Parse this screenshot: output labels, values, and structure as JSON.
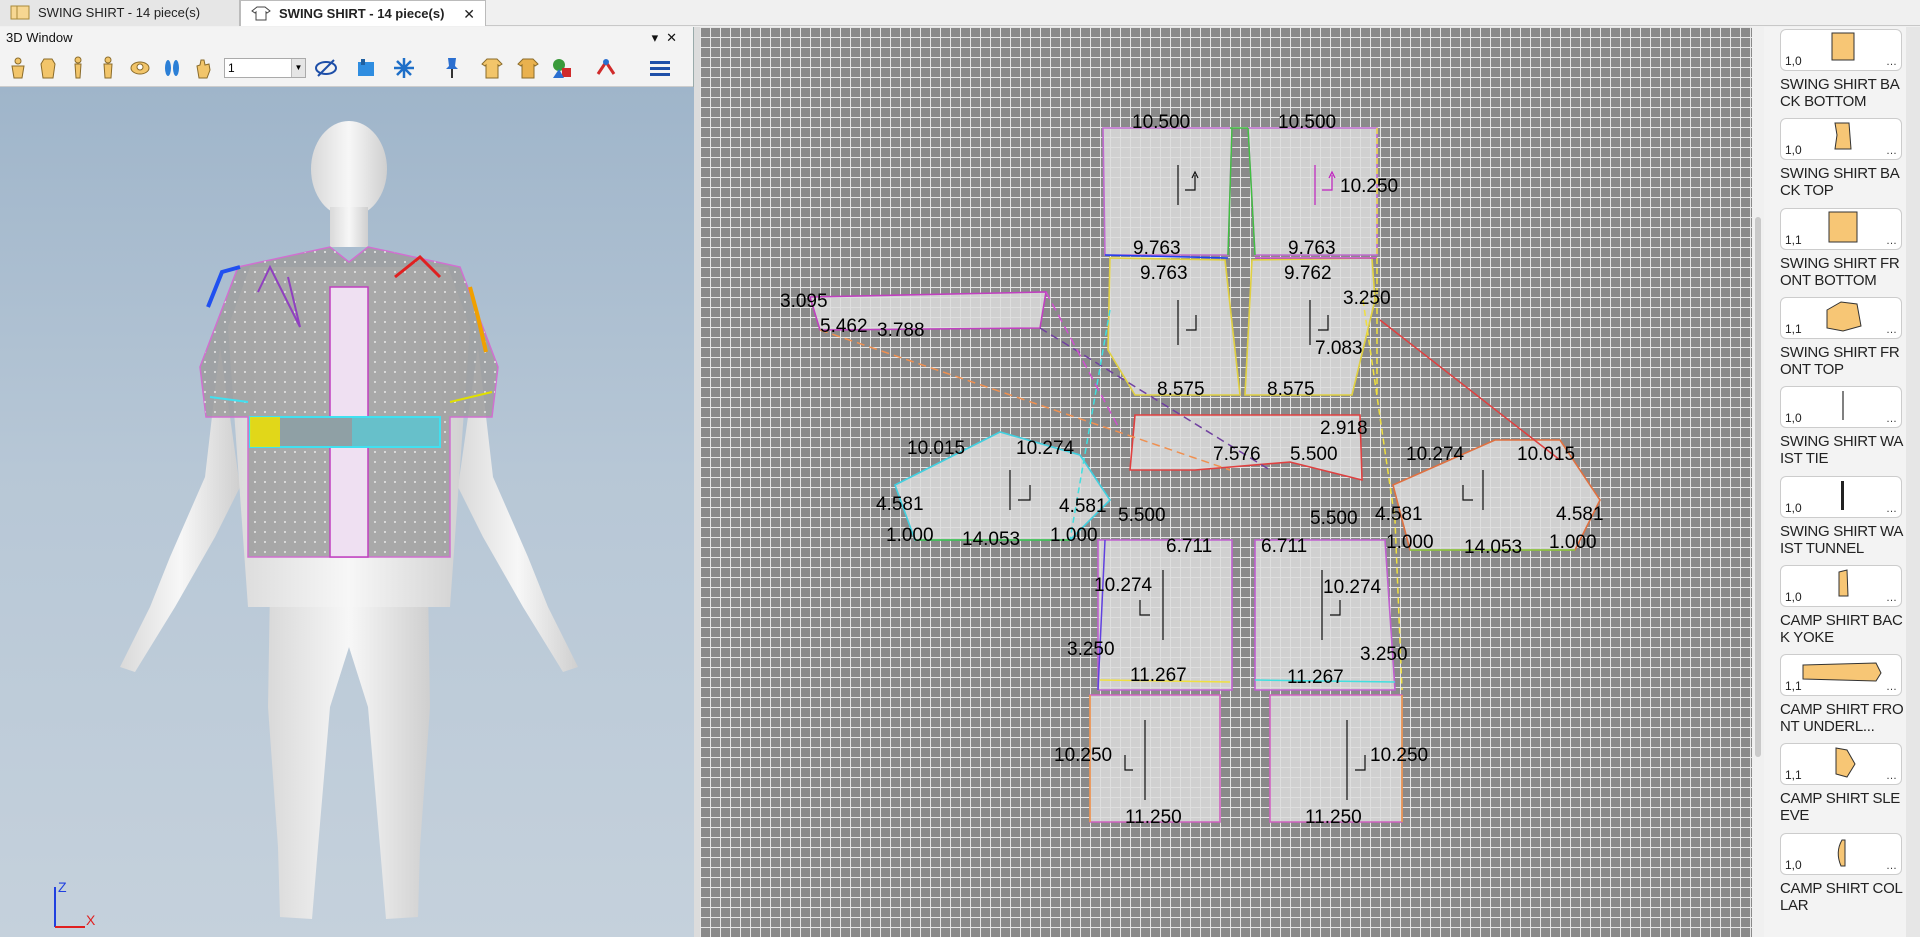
{
  "tabs": [
    {
      "label": "SWING SHIRT  -  14 piece(s)",
      "active": false
    },
    {
      "label": "SWING SHIRT  -  14 piece(s)",
      "active": true
    }
  ],
  "window_3d": {
    "title": "3D Window",
    "layer_value": "1",
    "axis_z": "Z",
    "axis_x": "X"
  },
  "library": [
    {
      "version": "1,0",
      "name": "SWING SHIRT BACK BOTTOM"
    },
    {
      "version": "1,0",
      "name": "SWING SHIRT BACK TOP"
    },
    {
      "version": "1,1",
      "name": "SWING SHIRT FRONT BOTTOM"
    },
    {
      "version": "1,1",
      "name": "SWING SHIRT FRONT TOP"
    },
    {
      "version": "1,0",
      "name": "SWING SHIRT WAIST TIE"
    },
    {
      "version": "1,0",
      "name": "SWING SHIRT WAIST TUNNEL"
    },
    {
      "version": "1,0",
      "name": "CAMP SHIRT BACK YOKE"
    },
    {
      "version": "1,1",
      "name": "CAMP SHIRT FRONT UNDERL..."
    },
    {
      "version": "1,1",
      "name": "CAMP SHIRT SLEEVE"
    },
    {
      "version": "1,0",
      "name": "CAMP SHIRT COLLAR"
    }
  ],
  "measurements": {
    "a": "10.500",
    "b": "10.500",
    "c": "10.250",
    "d": "9.763",
    "e": "9.763",
    "f": "9.763",
    "g": "9.762",
    "h": "3.250",
    "i": "3.095",
    "j": "5.462",
    "k": "3.788",
    "l": "7.083",
    "m": "8.575",
    "n": "8.575",
    "o": "2.918",
    "p": "7.576",
    "q": "5.500",
    "r": "10.015",
    "s": "10.274",
    "t": "10.274",
    "u": "10.015",
    "v": "4.581",
    "w": "4.581",
    "x": "5.500",
    "y": "5.500",
    "z": "4.581",
    "aa": "4.581",
    "ab": "1.000",
    "ac": "14.053",
    "ad": "1.000",
    "ae": "1.000",
    "af": "14.053",
    "ag": "1.000",
    "ah": "6.711",
    "ai": "6.711",
    "aj": "10.274",
    "ak": "10.274",
    "al": "3.250",
    "am": "3.250",
    "an": "11.267",
    "ao": "11.267",
    "ap": "10.250",
    "aq": "10.250",
    "ar": "11.250",
    "as": "11.250"
  },
  "colors": {
    "accent_piece": "#f7c675",
    "grid_bg": "#8a8a8a",
    "viewport_top": "#9fb5ca"
  }
}
